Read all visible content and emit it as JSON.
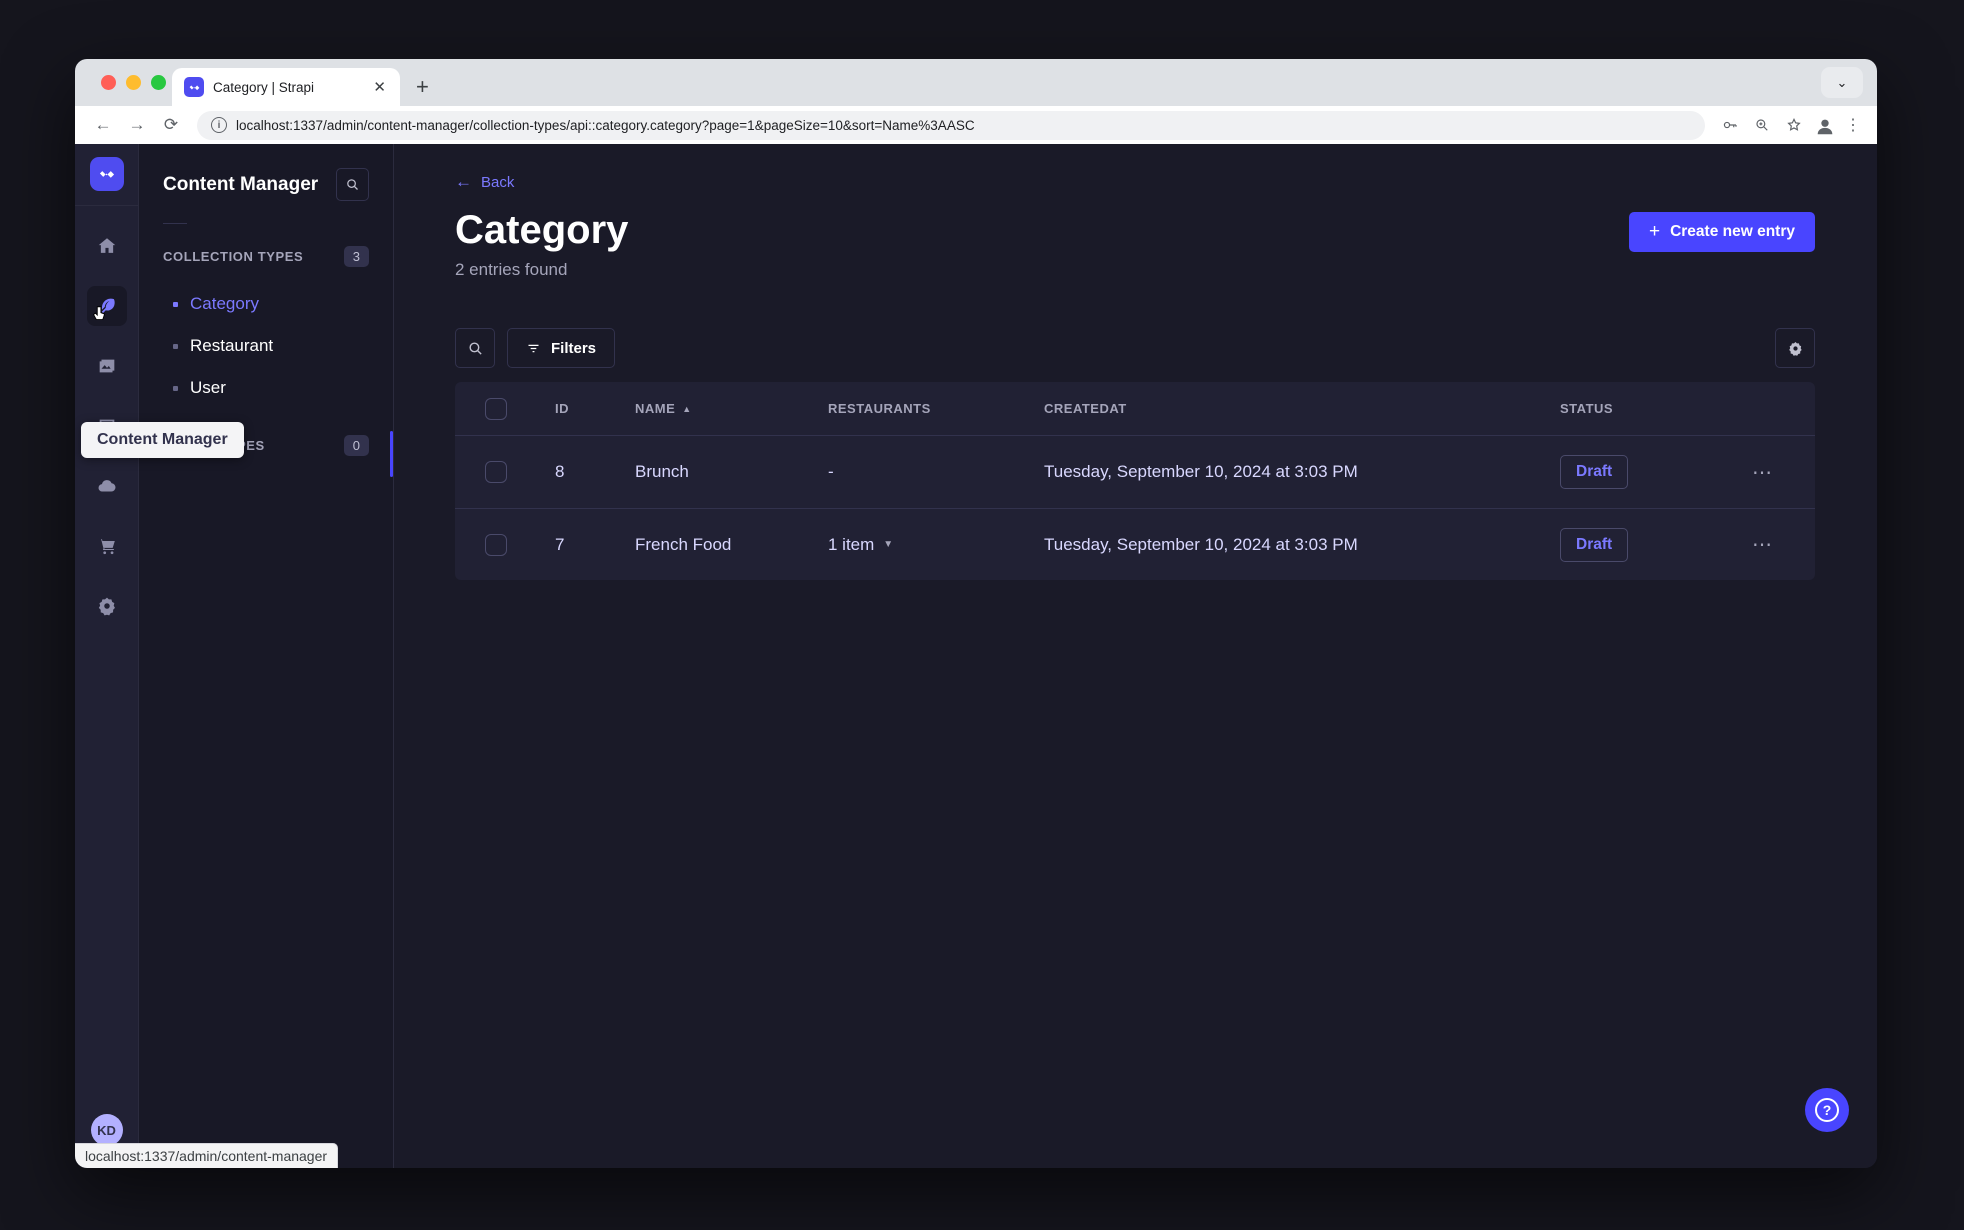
{
  "browser": {
    "tab_title": "Category | Strapi",
    "tab_close": "✕",
    "new_tab": "+",
    "url": "localhost:1337/admin/content-manager/collection-types/api::category.category?page=1&pageSize=10&sort=Name%3AASC",
    "back": "←",
    "forward": "→",
    "reload": "⟳",
    "info": "i"
  },
  "subnav": {
    "title": "Content Manager",
    "collection_types_label": "COLLECTION TYPES",
    "collection_types_count": "3",
    "items": [
      {
        "label": "Category"
      },
      {
        "label": "Restaurant"
      },
      {
        "label": "User"
      }
    ],
    "single_types_label": "SINGLE TYPES",
    "single_types_count": "0",
    "tooltip": "Content Manager"
  },
  "header": {
    "back_label": "Back",
    "back_arrow": "←",
    "title": "Category",
    "subtitle": "2 entries found",
    "create_button": "Create new entry",
    "plus": "+"
  },
  "filters": {
    "button_label": "Filters"
  },
  "table": {
    "headers": {
      "id": "ID",
      "name": "NAME",
      "sort_asc": "▲",
      "restaurants": "RESTAURANTS",
      "createdat": "CREATEDAT",
      "status": "STATUS"
    },
    "rows": [
      {
        "id": "8",
        "name": "Brunch",
        "restaurants": "-",
        "createdat": "Tuesday, September 10, 2024 at 3:03 PM",
        "status": "Draft"
      },
      {
        "id": "7",
        "name": "French Food",
        "restaurants": "1 item",
        "caret": "▼",
        "createdat": "Tuesday, September 10, 2024 at 3:03 PM",
        "status": "Draft"
      }
    ],
    "row_actions": "⋯"
  },
  "user": {
    "initials": "KD"
  },
  "statusbar": {
    "url": "localhost:1337/admin/content-manager"
  },
  "help": {
    "label": "?"
  },
  "colors": {
    "primary": "#4945ff",
    "link_purple": "#7b79ff",
    "page_bg": "#181826",
    "card_bg": "#212134",
    "border": "#32324d"
  }
}
